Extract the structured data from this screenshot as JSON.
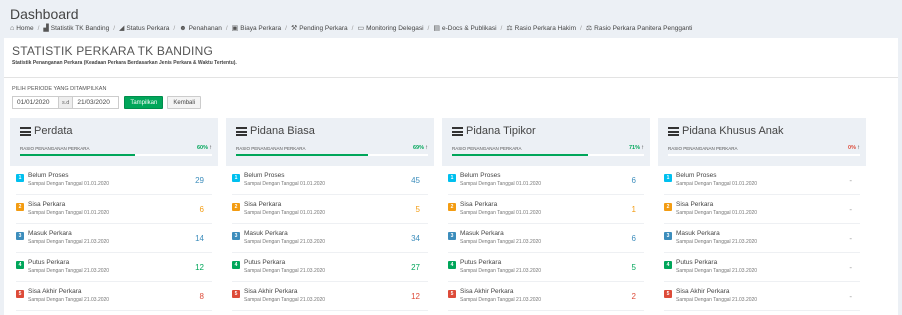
{
  "header": {
    "title": "Dashboard",
    "breadcrumbs": [
      {
        "label": "Home",
        "icon": "home-icon"
      },
      {
        "label": "Statistik TK Banding",
        "icon": "bar-chart-icon"
      },
      {
        "label": "Status Perkara",
        "icon": "line-chart-icon"
      },
      {
        "label": "Penahanan",
        "icon": "users-icon"
      },
      {
        "label": "Biaya Perkara",
        "icon": "money-icon"
      },
      {
        "label": "Pending Perkara",
        "icon": "gavel-icon"
      },
      {
        "label": "Monitoring Delegasi",
        "icon": "desktop-icon"
      },
      {
        "label": "e-Docs & Publikasi",
        "icon": "file-icon"
      },
      {
        "label": "Rasio Perkara Hakim",
        "icon": "scale-icon"
      },
      {
        "label": "Rasio Perkara Panitera Pengganti",
        "icon": "scale-icon"
      }
    ]
  },
  "panel": {
    "title": "STATISTIK PERKARA TK BANDING",
    "subtitle": "Statistik Penanganan Perkara (Keadaan Perkara Berdasarkan Jenis Perkara & Waktu Tertentu)."
  },
  "period": {
    "label": "PILIH PERIODE YANG DITAMPILKAN",
    "start": "01/01/2020",
    "sd": "s.d",
    "end": "21/03/2020",
    "show_label": "Tampilkan",
    "back_label": "Kembali"
  },
  "colors": {
    "green": "#00a65a",
    "red": "#dd4b39",
    "aqua": "#00c0ef",
    "orange": "#f39c12",
    "blue": "#3c8dbc"
  },
  "row_labels": [
    {
      "title": "Belum Proses",
      "sub": "Sampai Dengan Tanggal 01.01.2020",
      "color": "#00c0ef",
      "num": "1"
    },
    {
      "title": "Sisa Perkara",
      "sub": "Sampai Dengan Tanggal 01.01.2020",
      "color": "#f39c12",
      "num": "2"
    },
    {
      "title": "Masuk Perkara",
      "sub": "Sampai Dengan Tanggal 21.03.2020",
      "color": "#3c8dbc",
      "num": "3"
    },
    {
      "title": "Putus Perkara",
      "sub": "Sampai Dengan Tanggal 21.03.2020",
      "color": "#00a65a",
      "num": "4"
    },
    {
      "title": "Sisa Akhir Perkara",
      "sub": "Sampai Dengan Tanggal 21.03.2020",
      "color": "#dd4b39",
      "num": "5"
    }
  ],
  "value_colors": [
    "#3c8dbc",
    "#f39c12",
    "#3c8dbc",
    "#00a65a",
    "#dd4b39"
  ],
  "cards": [
    {
      "title": "Perdata",
      "ratio_label": "RASIO PENANGANAN PERKARA",
      "ratio": "60%",
      "ratio_fraction": 0.6,
      "ratio_color": "#00a65a",
      "arrow": "↑",
      "values": [
        "29",
        "6",
        "14",
        "12",
        "8"
      ]
    },
    {
      "title": "Pidana Biasa",
      "ratio_label": "RASIO PENANGANAN PERKARA",
      "ratio": "69%",
      "ratio_fraction": 0.69,
      "ratio_color": "#00a65a",
      "arrow": "↑",
      "values": [
        "45",
        "5",
        "34",
        "27",
        "12"
      ]
    },
    {
      "title": "Pidana Tipikor",
      "ratio_label": "RASIO PENANGANAN PERKARA",
      "ratio": "71%",
      "ratio_fraction": 0.71,
      "ratio_color": "#00a65a",
      "arrow": "↑",
      "values": [
        "6",
        "1",
        "6",
        "5",
        "2"
      ]
    },
    {
      "title": "Pidana Khusus Anak",
      "ratio_label": "RASIO PENANGANAN PERKARA",
      "ratio": "0%",
      "ratio_fraction": 0,
      "ratio_color": "#dd4b39",
      "arrow": "↑",
      "values": [
        "-",
        "-",
        "-",
        "-",
        "-"
      ]
    }
  ]
}
